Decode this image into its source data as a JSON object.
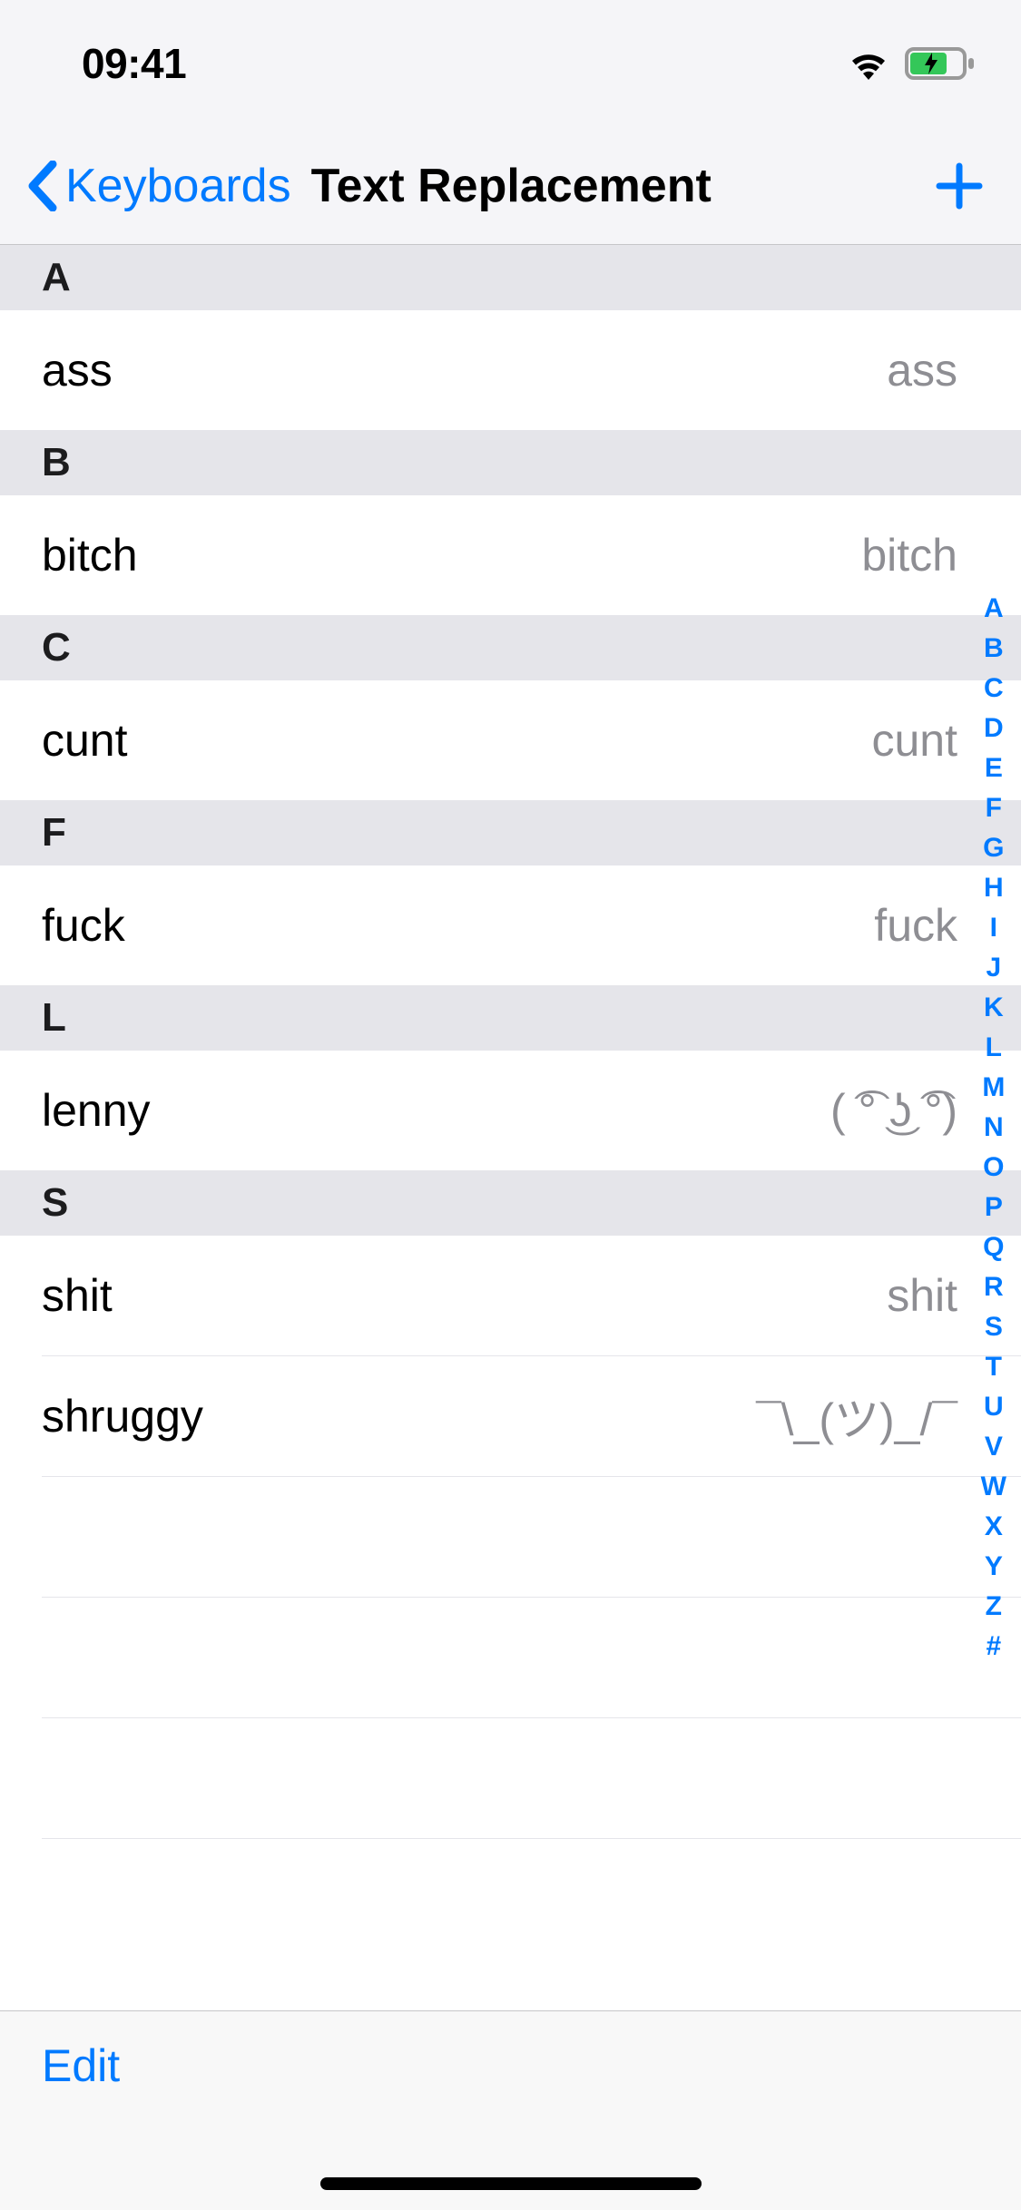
{
  "status": {
    "time": "09:41"
  },
  "nav": {
    "back_label": "Keyboards",
    "title": "Text Replacement"
  },
  "sections": [
    {
      "letter": "A",
      "items": [
        {
          "shortcut": "ass",
          "phrase": "ass"
        }
      ]
    },
    {
      "letter": "B",
      "items": [
        {
          "shortcut": "bitch",
          "phrase": "bitch"
        }
      ]
    },
    {
      "letter": "C",
      "items": [
        {
          "shortcut": "cunt",
          "phrase": "cunt"
        }
      ]
    },
    {
      "letter": "F",
      "items": [
        {
          "shortcut": "fuck",
          "phrase": "fuck"
        }
      ]
    },
    {
      "letter": "L",
      "items": [
        {
          "shortcut": "lenny",
          "phrase": "( ͡° ͜ʖ ͡°)"
        }
      ]
    },
    {
      "letter": "S",
      "items": [
        {
          "shortcut": "shit",
          "phrase": "shit"
        },
        {
          "shortcut": "shruggy",
          "phrase": "¯\\_(ツ)_/¯"
        }
      ]
    }
  ],
  "alpha_index": [
    "A",
    "B",
    "C",
    "D",
    "E",
    "F",
    "G",
    "H",
    "I",
    "J",
    "K",
    "L",
    "M",
    "N",
    "O",
    "P",
    "Q",
    "R",
    "S",
    "T",
    "U",
    "V",
    "W",
    "X",
    "Y",
    "Z",
    "#"
  ],
  "toolbar": {
    "edit_label": "Edit"
  }
}
